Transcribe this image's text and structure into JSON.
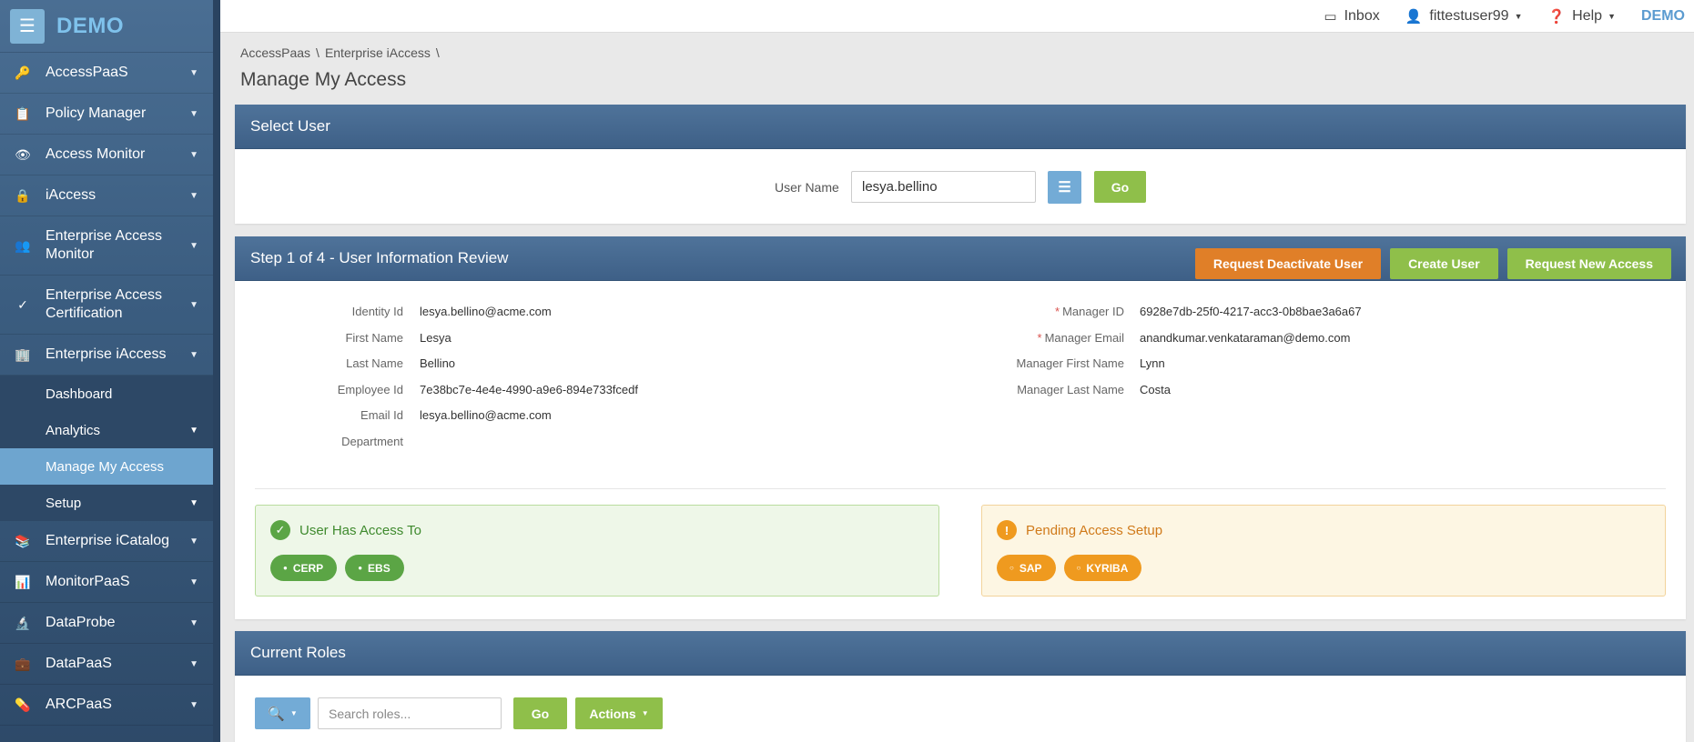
{
  "brand": {
    "name": "DEMO",
    "menu_icon": "hamburger-icon"
  },
  "sidebar": {
    "items": [
      {
        "label": "AccessPaaS",
        "icon": "key-icon"
      },
      {
        "label": "Policy Manager",
        "icon": "clipboard-icon"
      },
      {
        "label": "Access Monitor",
        "icon": "eye-icon"
      },
      {
        "label": "iAccess",
        "icon": "lock-icon"
      },
      {
        "label": "Enterprise Access Monitor",
        "icon": "users-icon"
      },
      {
        "label": "Enterprise Access Certification",
        "icon": "check-icon"
      },
      {
        "label": "Enterprise iAccess",
        "icon": "building-icon"
      },
      {
        "label": "Enterprise iCatalog",
        "icon": "catalog-icon"
      },
      {
        "label": "MonitorPaaS",
        "icon": "bar-chart-icon"
      },
      {
        "label": "DataProbe",
        "icon": "microscope-icon"
      },
      {
        "label": "DataPaaS",
        "icon": "briefcase-icon"
      },
      {
        "label": "ARCPaaS",
        "icon": "pill-icon"
      }
    ],
    "subitems": [
      {
        "label": "Dashboard"
      },
      {
        "label": "Analytics"
      },
      {
        "label": "Manage My Access"
      },
      {
        "label": "Setup"
      }
    ]
  },
  "topbar": {
    "inbox": "Inbox",
    "user": "fittestuser99",
    "help": "Help",
    "tenant": "DEMO"
  },
  "breadcrumb": [
    "AccessPaas",
    "Enterprise iAccess"
  ],
  "page_title": "Manage My Access",
  "select_user": {
    "title": "Select User",
    "label": "User Name",
    "value": "lesya.bellino",
    "go": "Go"
  },
  "step": {
    "title": "Step 1 of 4 - User Information Review",
    "actions": {
      "deactivate": "Request Deactivate User",
      "create": "Create User",
      "request_new": "Request New Access"
    },
    "left_fields": [
      {
        "label": "Identity Id",
        "value": "lesya.bellino@acme.com"
      },
      {
        "label": "First Name",
        "value": "Lesya"
      },
      {
        "label": "Last Name",
        "value": "Bellino"
      },
      {
        "label": "Employee Id",
        "value": "7e38bc7e-4e4e-4990-a9e6-894e733fcedf"
      },
      {
        "label": "Email Id",
        "value": "lesya.bellino@acme.com"
      },
      {
        "label": "Department",
        "value": ""
      }
    ],
    "right_fields": [
      {
        "label": "Manager ID",
        "value": "6928e7db-25f0-4217-acc3-0b8bae3a6a67",
        "required": "*"
      },
      {
        "label": "Manager Email",
        "value": "anandkumar.venkataraman@demo.com",
        "required": "*"
      },
      {
        "label": "Manager First Name",
        "value": "Lynn"
      },
      {
        "label": "Manager Last Name",
        "value": "Costa"
      }
    ],
    "has_access": {
      "title": "User Has Access To",
      "icon": "check-circle-icon",
      "chips": [
        "CERP",
        "EBS"
      ]
    },
    "pending": {
      "title": "Pending Access Setup",
      "icon": "exclamation-circle-icon",
      "chips": [
        "SAP",
        "KYRIBA"
      ]
    }
  },
  "roles": {
    "title": "Current Roles",
    "search_placeholder": "Search roles...",
    "go": "Go",
    "actions": "Actions"
  },
  "colors": {
    "sidebar_bg": "#3b5d80",
    "accent_blue": "#73abd6",
    "green": "#8fbf4a",
    "orange": "#e07f28",
    "panel_header": "#476a91"
  }
}
